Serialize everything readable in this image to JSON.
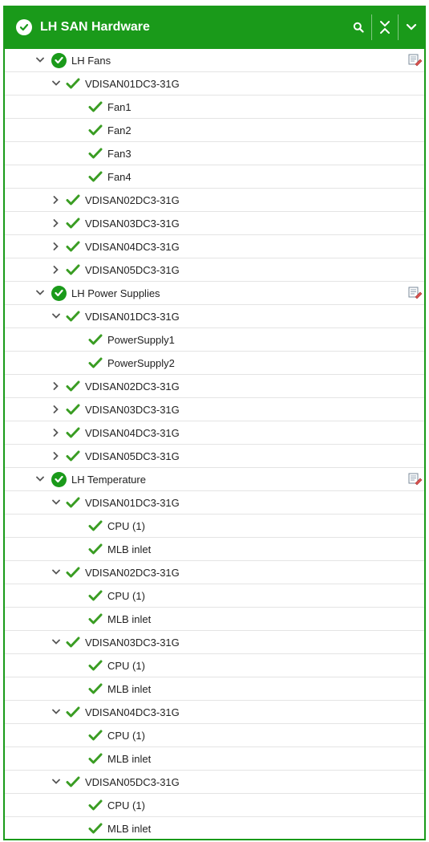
{
  "header": {
    "title": "LH SAN Hardware"
  },
  "groups": [
    {
      "label": "LH Fans",
      "nodes": [
        {
          "label": "VDISAN01DC3-31G",
          "expanded": true,
          "children": [
            "Fan1",
            "Fan2",
            "Fan3",
            "Fan4"
          ]
        },
        {
          "label": "VDISAN02DC3-31G",
          "expanded": false,
          "children": []
        },
        {
          "label": "VDISAN03DC3-31G",
          "expanded": false,
          "children": []
        },
        {
          "label": "VDISAN04DC3-31G",
          "expanded": false,
          "children": []
        },
        {
          "label": "VDISAN05DC3-31G",
          "expanded": false,
          "children": []
        }
      ]
    },
    {
      "label": "LH Power Supplies",
      "nodes": [
        {
          "label": "VDISAN01DC3-31G",
          "expanded": true,
          "children": [
            "PowerSupply1",
            "PowerSupply2"
          ]
        },
        {
          "label": "VDISAN02DC3-31G",
          "expanded": false,
          "children": []
        },
        {
          "label": "VDISAN03DC3-31G",
          "expanded": false,
          "children": []
        },
        {
          "label": "VDISAN04DC3-31G",
          "expanded": false,
          "children": []
        },
        {
          "label": "VDISAN05DC3-31G",
          "expanded": false,
          "children": []
        }
      ]
    },
    {
      "label": "LH Temperature",
      "nodes": [
        {
          "label": "VDISAN01DC3-31G",
          "expanded": true,
          "children": [
            "CPU (1)",
            "MLB inlet"
          ]
        },
        {
          "label": "VDISAN02DC3-31G",
          "expanded": true,
          "children": [
            "CPU (1)",
            "MLB inlet"
          ]
        },
        {
          "label": "VDISAN03DC3-31G",
          "expanded": true,
          "children": [
            "CPU (1)",
            "MLB inlet"
          ]
        },
        {
          "label": "VDISAN04DC3-31G",
          "expanded": true,
          "children": [
            "CPU (1)",
            "MLB inlet"
          ]
        },
        {
          "label": "VDISAN05DC3-31G",
          "expanded": true,
          "children": [
            "CPU (1)",
            "MLB inlet"
          ]
        }
      ]
    }
  ],
  "colors": {
    "accent": "#1a9a1a",
    "check": "#3a9d23"
  },
  "icons": {
    "header_status": "check-circle-icon",
    "search": "search-icon",
    "collapse_all": "collapse-all-icon",
    "menu": "chevron-down-icon",
    "status_ok": "check-icon",
    "edit": "edit-icon"
  }
}
